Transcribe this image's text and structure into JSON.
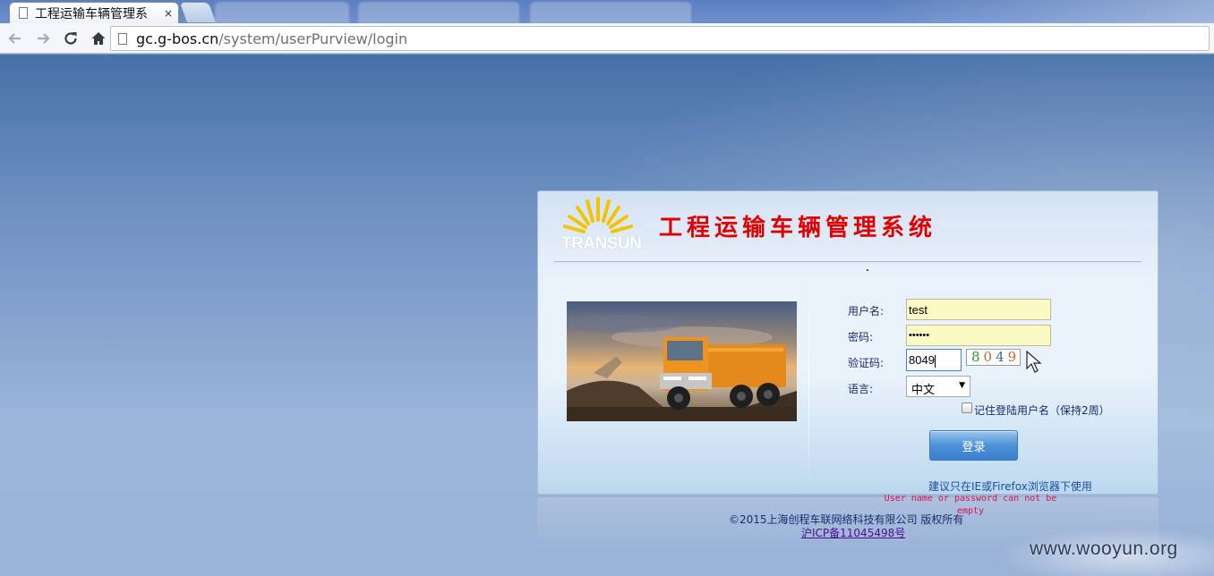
{
  "browser": {
    "active_tab_title": "工程运输车辆管理系",
    "tab_close_glyph": "×",
    "url_host": "gc.g-bos.cn",
    "url_path": "/system/userPurview/login"
  },
  "header": {
    "logo_text": "TRANSUN",
    "system_title": "工程运输车辆管理系统"
  },
  "form": {
    "username_label": "用户名:",
    "username_value": "test",
    "password_label": "密码:",
    "password_value": "••••••",
    "captcha_label": "验证码:",
    "captcha_value": "8049",
    "captcha_image_chars": [
      "8",
      "0",
      "4",
      "9"
    ],
    "language_label": "语言:",
    "language_selected": "中文",
    "remember_label": "记住登陆用户名（保持2周）",
    "remember_checked": false,
    "login_button": "登录",
    "browser_tip": "建议只在IE或Firefox浏览器下使用"
  },
  "error_message": "User name or password can not be empty",
  "footer": {
    "copyright": "©2015上海创程车联网络科技有限公司 版权所有",
    "icp": "沪ICP备11045498号"
  },
  "watermark": "www.wooyun.org",
  "colors": {
    "title_red": "#e00000",
    "field_yellow": "#fafac2",
    "error_pink": "#e0104a",
    "button_blue": "#4c91d8"
  }
}
